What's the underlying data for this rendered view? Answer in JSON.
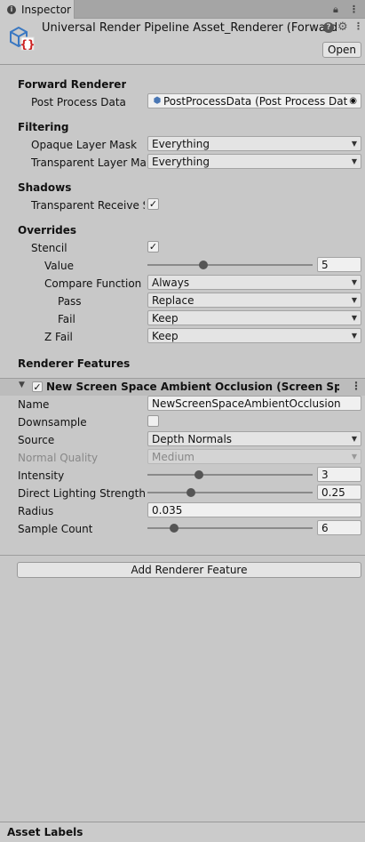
{
  "tab": {
    "label": "Inspector"
  },
  "header": {
    "title": "Universal Render Pipeline Asset_Renderer (Forward",
    "open_label": "Open"
  },
  "forward_renderer": {
    "heading": "Forward Renderer",
    "post_process_label": "Post Process Data",
    "post_process_value": "PostProcessData (Post Process Data"
  },
  "filtering": {
    "heading": "Filtering",
    "opaque_label": "Opaque Layer Mask",
    "opaque_value": "Everything",
    "transparent_label": "Transparent Layer Mas",
    "transparent_value": "Everything"
  },
  "shadows": {
    "heading": "Shadows",
    "receive_label": "Transparent Receive S",
    "receive_checked": true
  },
  "overrides": {
    "heading": "Overrides",
    "stencil_label": "Stencil",
    "stencil_checked": true,
    "value_label": "Value",
    "value": "5",
    "value_fraction": 0.33,
    "compare_label": "Compare Function",
    "compare_value": "Always",
    "pass_label": "Pass",
    "pass_value": "Replace",
    "fail_label": "Fail",
    "fail_value": "Keep",
    "zfail_label": "Z Fail",
    "zfail_value": "Keep"
  },
  "renderer_features": {
    "heading": "Renderer Features",
    "feature_title": "New Screen Space Ambient Occlusion (Screen Space",
    "feature_enabled": true,
    "name_label": "Name",
    "name_value": "NewScreenSpaceAmbientOcclusion",
    "downsample_label": "Downsample",
    "downsample_checked": false,
    "source_label": "Source",
    "source_value": "Depth Normals",
    "normal_quality_label": "Normal Quality",
    "normal_quality_value": "Medium",
    "intensity_label": "Intensity",
    "intensity_value": "3",
    "intensity_fraction": 0.3,
    "direct_label": "Direct Lighting Strength",
    "direct_value": "0.25",
    "direct_fraction": 0.25,
    "radius_label": "Radius",
    "radius_value": "0.035",
    "sample_label": "Sample Count",
    "sample_value": "6",
    "sample_fraction": 0.14,
    "add_label": "Add Renderer Feature"
  },
  "footer": {
    "label": "Asset Labels"
  },
  "glyphs": {
    "check": "✓",
    "arrow": "▼",
    "triangle": "▼",
    "kebab": "⋮",
    "lock": "🔒",
    "menu": "⋮",
    "help": "?",
    "settings": "⚙"
  }
}
